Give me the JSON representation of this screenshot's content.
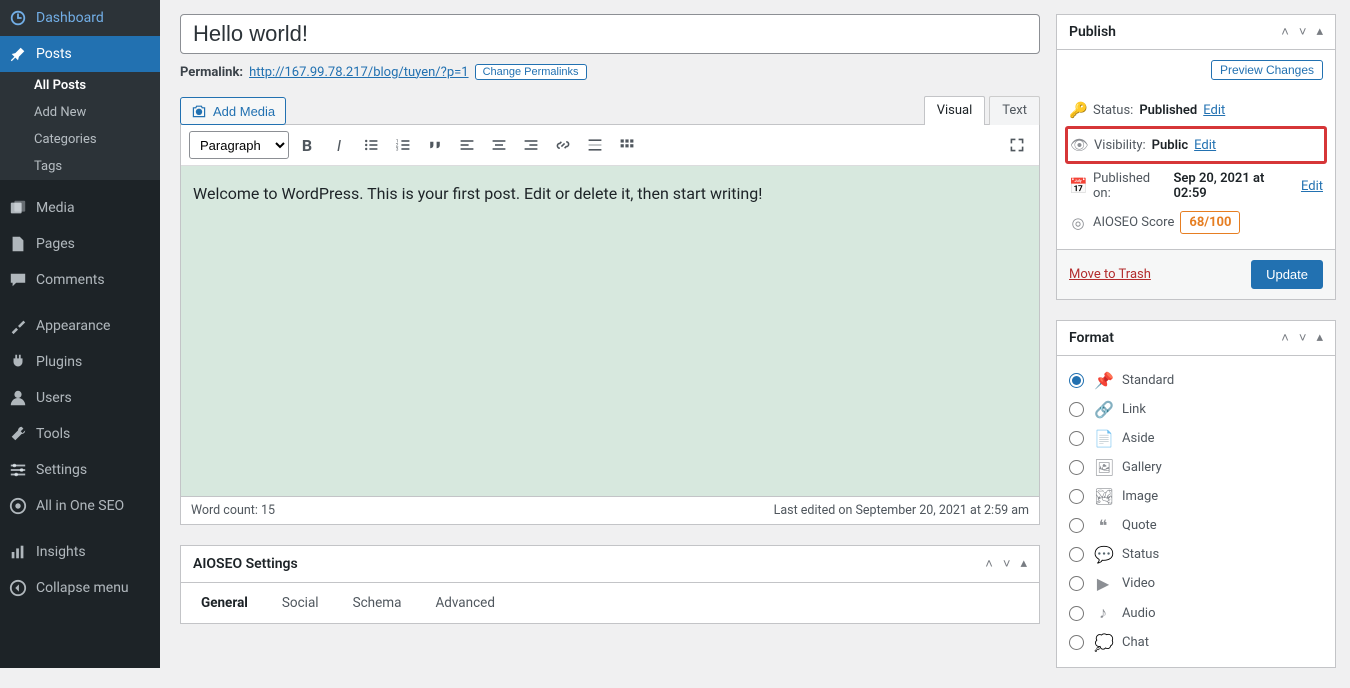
{
  "sidebar": {
    "dashboard": "Dashboard",
    "posts": "Posts",
    "all_posts": "All Posts",
    "add_new": "Add New",
    "categories": "Categories",
    "tags": "Tags",
    "media": "Media",
    "pages": "Pages",
    "comments": "Comments",
    "appearance": "Appearance",
    "plugins": "Plugins",
    "users": "Users",
    "tools": "Tools",
    "settings": "Settings",
    "aioseo": "All in One SEO",
    "insights": "Insights",
    "collapse": "Collapse menu"
  },
  "editor": {
    "title": "Hello world!",
    "permalink_label": "Permalink:",
    "permalink_url": "http://167.99.78.217/blog/tuyen/?p=1",
    "change_permalinks": "Change Permalinks",
    "add_media": "Add Media",
    "tab_visual": "Visual",
    "tab_text": "Text",
    "paragraph": "Paragraph",
    "content": "Welcome to WordPress. This is your first post. Edit or delete it, then start writing!",
    "word_count": "Word count: 15",
    "last_edited": "Last edited on September 20, 2021 at 2:59 am",
    "aioseo_title": "AIOSEO Settings",
    "aio_general": "General",
    "aio_social": "Social",
    "aio_schema": "Schema",
    "aio_advanced": "Advanced"
  },
  "publish": {
    "title": "Publish",
    "preview": "Preview Changes",
    "status_label": "Status:",
    "status_value": "Published",
    "visibility_label": "Visibility:",
    "visibility_value": "Public",
    "published_label": "Published on:",
    "published_value": "Sep 20, 2021 at 02:59",
    "aioseo_label": "AIOSEO Score",
    "aioseo_score": "68/100",
    "edit": "Edit",
    "trash": "Move to Trash",
    "update": "Update"
  },
  "format": {
    "title": "Format",
    "standard": "Standard",
    "link": "Link",
    "aside": "Aside",
    "gallery": "Gallery",
    "image": "Image",
    "quote": "Quote",
    "status": "Status",
    "video": "Video",
    "audio": "Audio",
    "chat": "Chat"
  }
}
